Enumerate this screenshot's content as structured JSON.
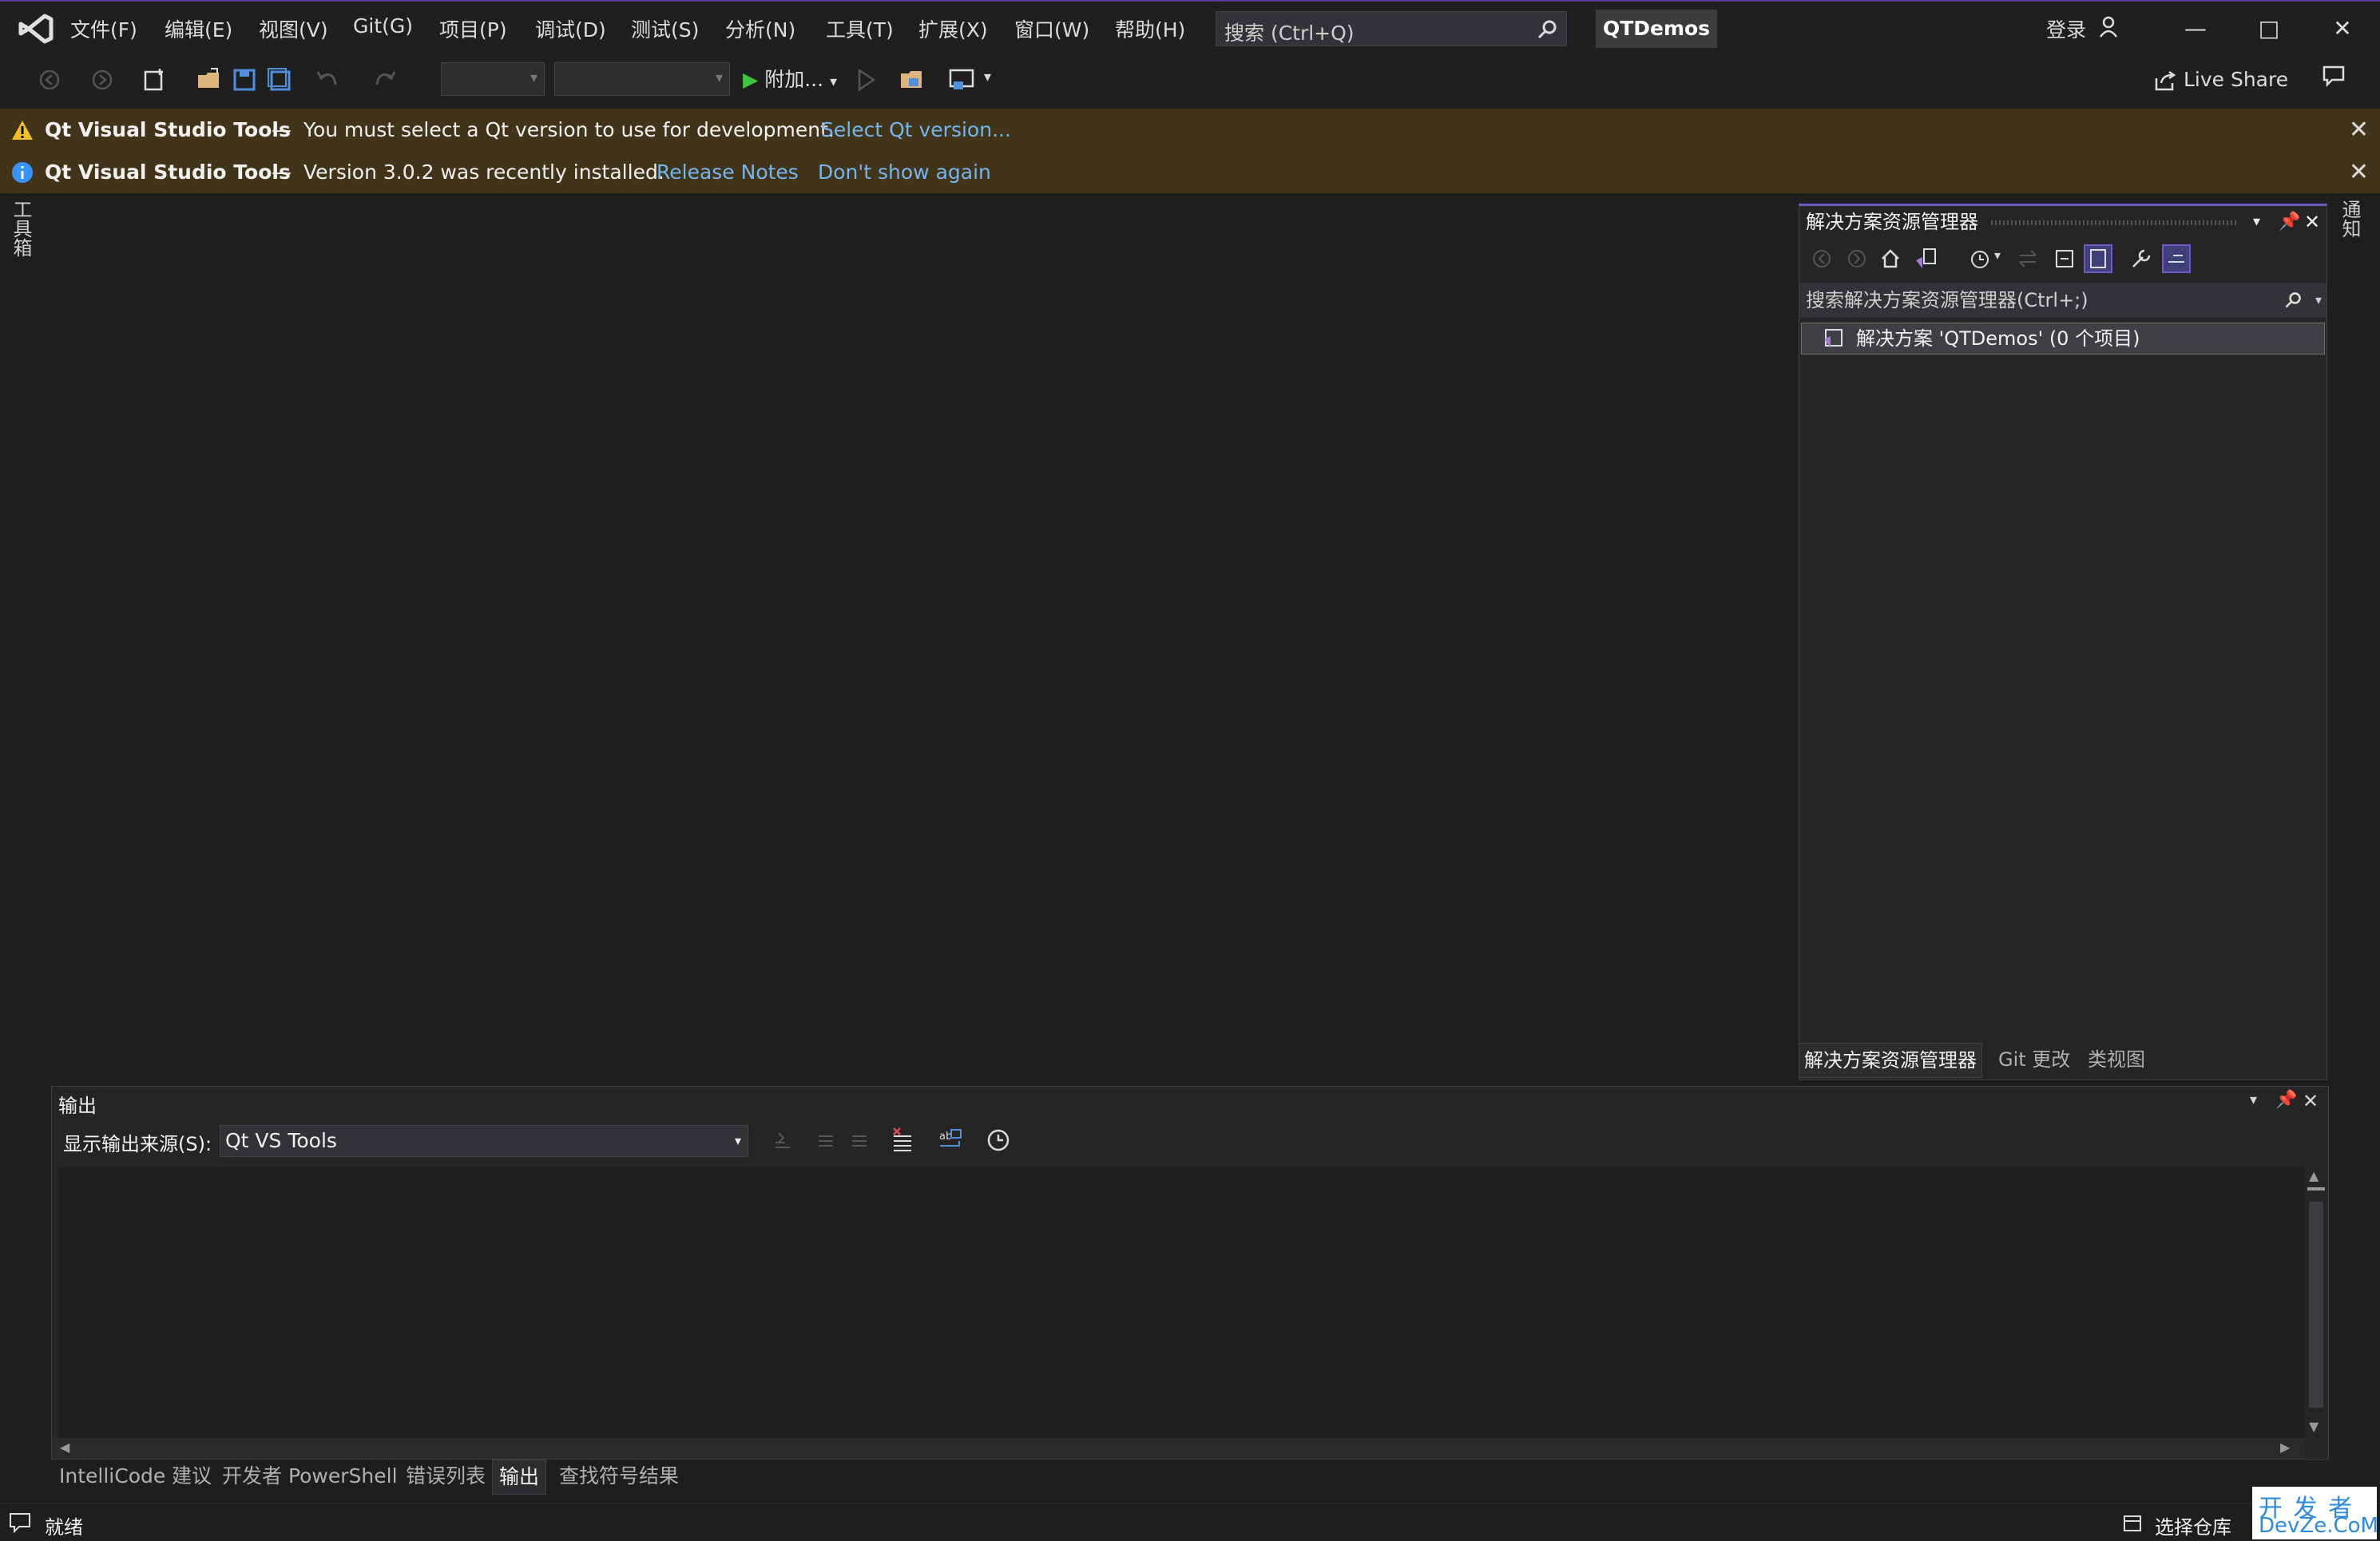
{
  "titlebar": {
    "menu": [
      "文件(F)",
      "编辑(E)",
      "视图(V)",
      "Git(G)",
      "项目(P)",
      "调试(D)",
      "测试(S)",
      "分析(N)",
      "工具(T)",
      "扩展(X)",
      "窗口(W)",
      "帮助(H)"
    ],
    "search_placeholder": "搜索 (Ctrl+Q)",
    "project_name": "QTDemos",
    "login_label": "登录"
  },
  "toolbar": {
    "attach_label": "附加...",
    "live_share_label": "Live Share"
  },
  "infobars": [
    {
      "title": "Qt Visual Studio Tools",
      "dash": "—",
      "message": "You must select a Qt version to use for development.",
      "links": [
        "Select Qt version..."
      ]
    },
    {
      "title": "Qt Visual Studio Tools",
      "dash": "—",
      "message": "Version 3.0.2 was recently installed.",
      "links": [
        "Release Notes",
        "Don't show again"
      ]
    }
  ],
  "side_tabs": {
    "toolbox": "工具箱",
    "notifications": "通知"
  },
  "solution_explorer": {
    "title": "解决方案资源管理器",
    "search_placeholder": "搜索解决方案资源管理器(Ctrl+;)",
    "root_item": "解决方案 'QTDemos' (0 个项目)",
    "tabs": [
      "解决方案资源管理器",
      "Git 更改",
      "类视图"
    ]
  },
  "output": {
    "title": "输出",
    "source_label": "显示输出来源(S):",
    "source_value": "Qt VS Tools"
  },
  "bottom_tabs": [
    "IntelliCode 建议",
    "开发者 PowerShell",
    "错误列表",
    "输出",
    "查找符号结果"
  ],
  "status": {
    "ready": "就绪",
    "repo": "选择仓库"
  },
  "watermark": {
    "line1": "开 发 者",
    "line2": "DevZe.CoM"
  },
  "colors": {
    "accent": "#6f58c9",
    "infobar_bg": "#413419",
    "link": "#74b6f0",
    "run_green": "#3ec43e"
  }
}
